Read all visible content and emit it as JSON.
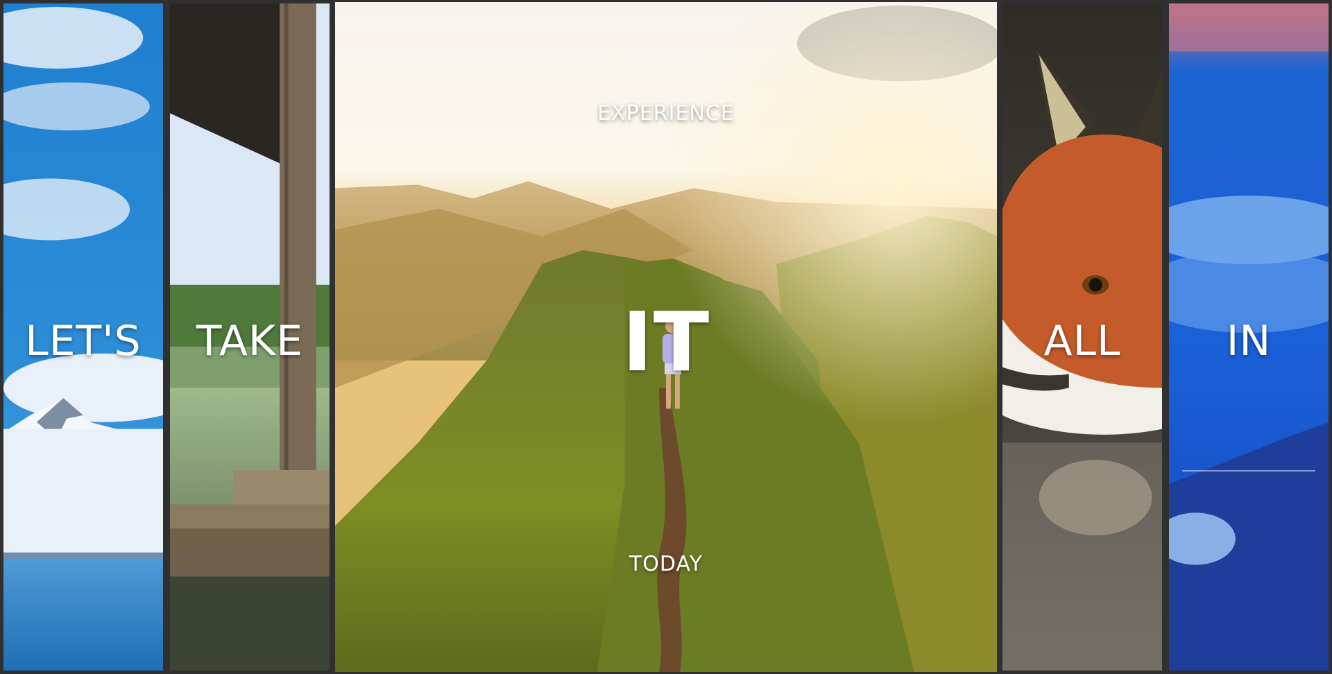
{
  "panels": [
    {
      "id": "lets",
      "word": "LET'S"
    },
    {
      "id": "take",
      "word": "TAKE"
    },
    {
      "id": "it",
      "word": "IT",
      "top_text": "EXPERIENCE",
      "bottom_text": "TODAY"
    },
    {
      "id": "all",
      "word": "ALL"
    },
    {
      "id": "in",
      "word": "IN"
    }
  ]
}
